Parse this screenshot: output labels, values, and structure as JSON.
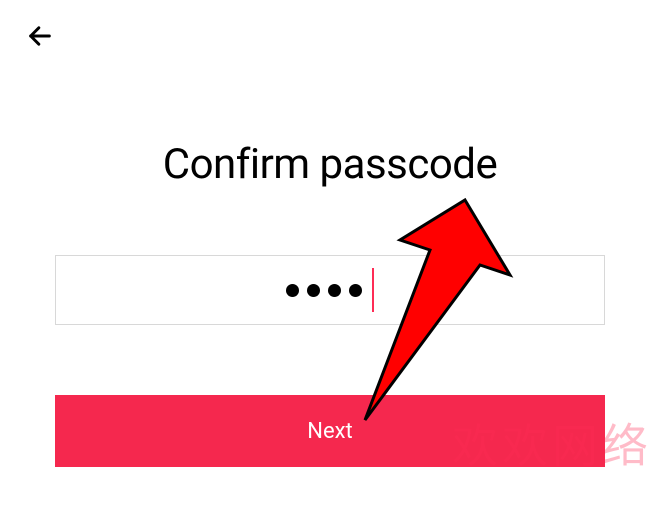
{
  "title": "Confirm passcode",
  "passcodeLength": 4,
  "nextButton": {
    "label": "Next"
  },
  "colors": {
    "accent": "#fe2c55",
    "buttonBg": "#f5284e",
    "arrowFill": "#ff0000",
    "arrowStroke": "#000000"
  },
  "watermark": "欢欢网络"
}
